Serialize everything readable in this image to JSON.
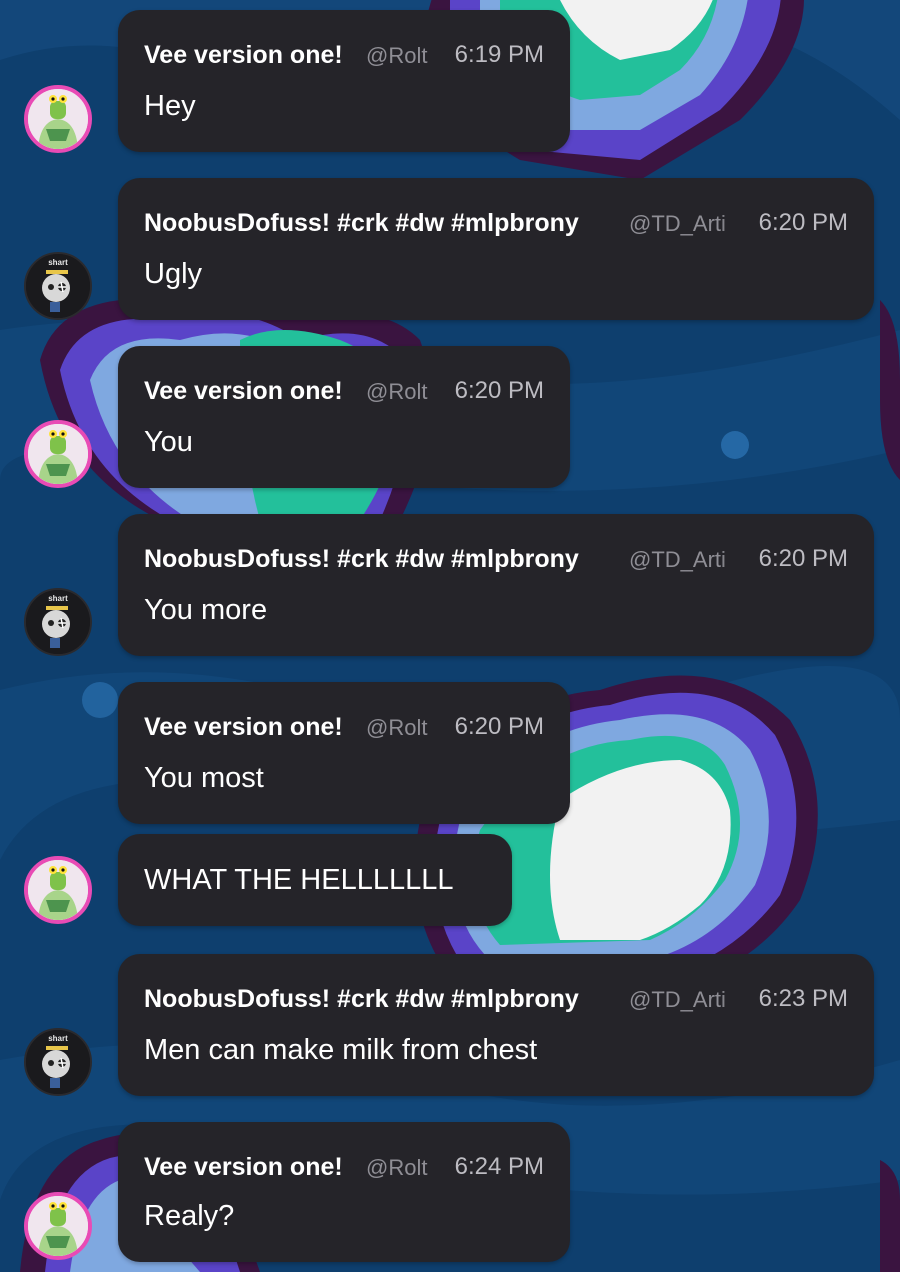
{
  "colors": {
    "background": "#0e3f6e",
    "bubble": "#252429",
    "vee_avatar_ring": "#e84bb5",
    "name_text": "#ffffff",
    "handle_text": "#8f8e95"
  },
  "messages": [
    {
      "author": "Vee version one!",
      "handle": "@Rolt",
      "time": "6:19 PM",
      "text": "Hey",
      "avatar_icon": "frog-character-avatar"
    },
    {
      "author": "NoobusDofuss! #crk #dw #mlpbrony",
      "handle": "@TD_Arti",
      "time": "6:20 PM",
      "text": "Ugly",
      "avatar_icon": "skull-character-avatar",
      "avatar_label": "shart"
    },
    {
      "author": "Vee version one!",
      "handle": "@Rolt",
      "time": "6:20 PM",
      "text": "You",
      "avatar_icon": "frog-character-avatar"
    },
    {
      "author": "NoobusDofuss! #crk #dw #mlpbrony",
      "handle": "@TD_Arti",
      "time": "6:20 PM",
      "text": "You more",
      "avatar_icon": "skull-character-avatar",
      "avatar_label": "shart"
    },
    {
      "author": "Vee version one!",
      "handle": "@Rolt",
      "time": "6:20 PM",
      "text": "You most",
      "avatar_icon": "frog-character-avatar"
    },
    {
      "text": "WHAT THE HELLLLLLL",
      "avatar_icon": "frog-character-avatar"
    },
    {
      "author": "NoobusDofuss! #crk #dw #mlpbrony",
      "handle": "@TD_Arti",
      "time": "6:23 PM",
      "text": "Men can make milk from chest",
      "avatar_icon": "skull-character-avatar",
      "avatar_label": "shart"
    },
    {
      "author": "Vee version one!",
      "handle": "@Rolt",
      "time": "6:24 PM",
      "text": "Realy?",
      "avatar_icon": "frog-character-avatar"
    }
  ]
}
